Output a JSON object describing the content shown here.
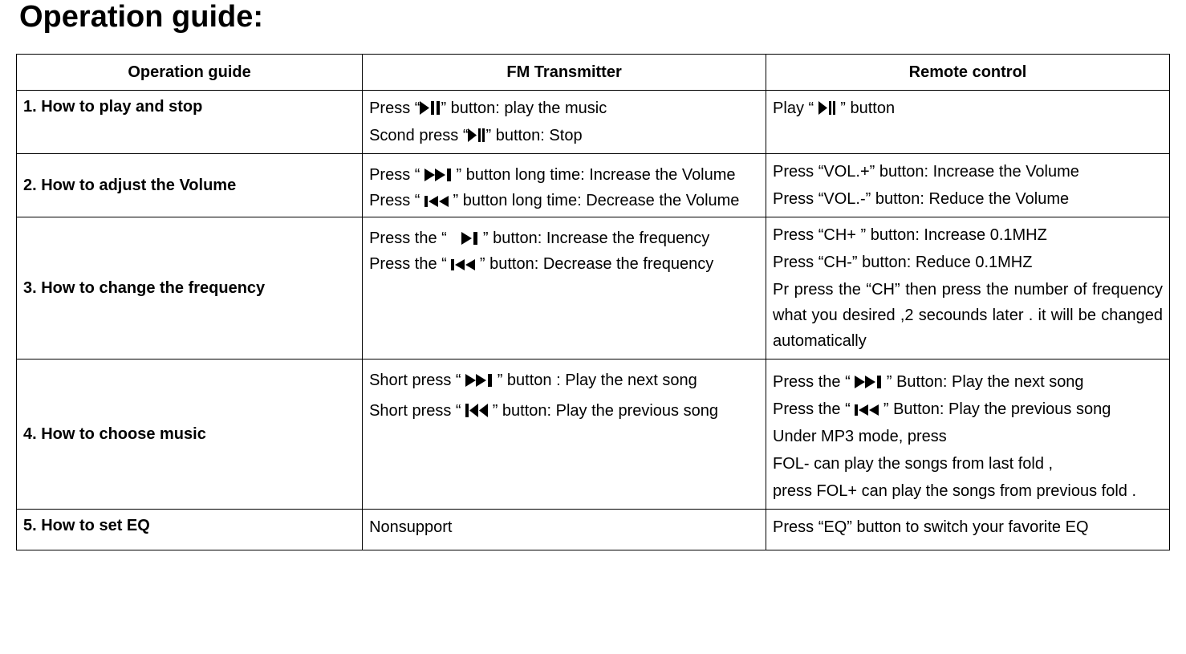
{
  "title": "Operation guide:",
  "headers": {
    "col1": "Operation guide",
    "col2": "FM Transmitter",
    "col3": "Remote control"
  },
  "rows": [
    {
      "label": "1. How to play and stop",
      "fm": {
        "line1a": "Press “",
        "line1b": "” button: play the music",
        "line2a": "Scond press “",
        "line2b": "” button: Stop"
      },
      "remote": {
        "line1a": "Play   “ ",
        "line1b": "  ” button"
      }
    },
    {
      "label": "2. How to adjust the Volume",
      "fm": {
        "line1a": "Press “  ",
        "line1b": "  ”  button long time: Increase the Volume",
        "line2a": "Press “ ",
        "line2b": " ”  button long time: Decrease the Volume"
      },
      "remote": {
        "line1": "Press “VOL.+” button: Increase the Volume",
        "line2": "Press “VOL.-” button: Reduce the Volume"
      }
    },
    {
      "label": "3. How to change the frequency",
      "fm": {
        "line1a": "Press the “ ",
        "line1b": " ” button: Increase the frequency",
        "line2a": "Press the “ ",
        "line2b": " ” button: Decrease the frequency"
      },
      "remote": {
        "line1": "Press “CH+ ” button: Increase 0.1MHZ",
        "line2": "Press “CH-” button: Reduce 0.1MHZ",
        "line3": "Pr press the “CH” then press the number of frequency what you desired ,2 secounds later . it will be changed automatically"
      }
    },
    {
      "label": "4. How to choose music",
      "fm": {
        "line1a": "Short press “  ",
        "line1b": "  ” button : Play the next song",
        "line2a": "Short press “ ",
        "line2b": " ” button: Play the previous song"
      },
      "remote": {
        "line1a": "Press the “  ",
        "line1b": "  ” Button: Play the next song",
        "line2a": "Press the “  ",
        "line2b": "  ” Button: Play the previous song",
        "line3": " Under MP3 mode, press",
        "line4": "FOL- can play   the songs from last fold ,",
        "line5": " press FOL+ can  play the songs from previous fold ."
      }
    },
    {
      "label": "5. How to set EQ",
      "fm": {
        "line1": "Nonsupport"
      },
      "remote": {
        "line1": "Press “EQ” button to switch your favorite EQ"
      }
    }
  ]
}
